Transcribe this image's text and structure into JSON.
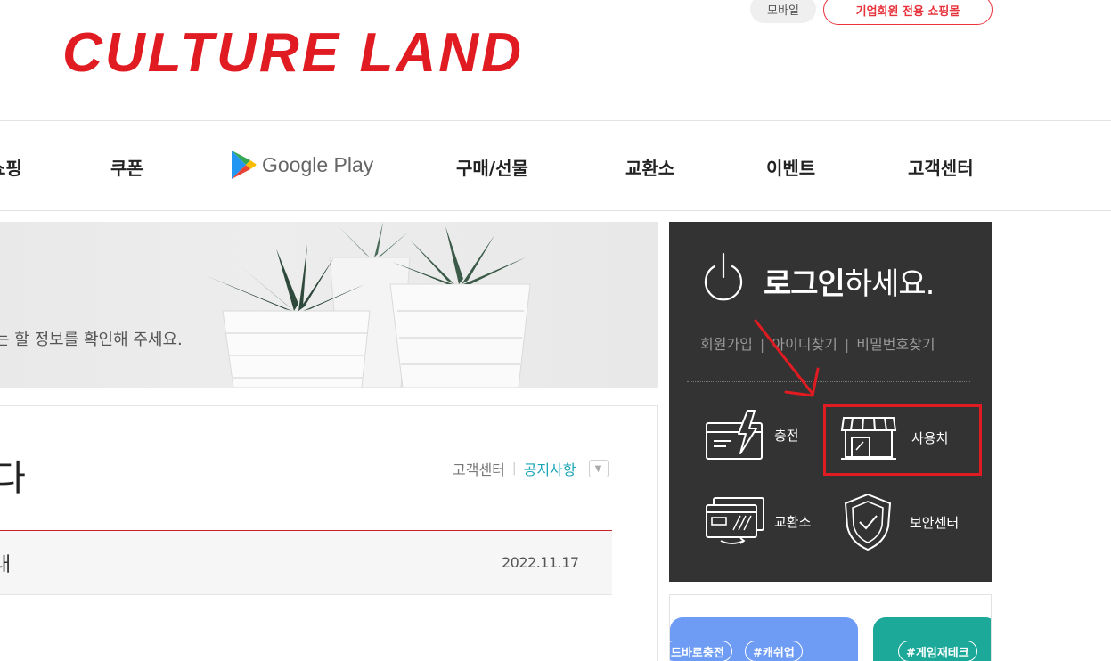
{
  "header": {
    "logo_text": "CULTURE LAND",
    "mobile_label": "모바일",
    "corporate_label": "기업회원 전용 쇼핑몰"
  },
  "nav": {
    "items": [
      "쇼핑",
      "쿠폰",
      "구매/선물",
      "교환소",
      "이벤트",
      "고객센터"
    ],
    "google_play_label": "Google Play"
  },
  "banner": {
    "text": "는 할 정보를 확인해 주세요."
  },
  "notice": {
    "heading_fragment": "다",
    "link_customer_center": "고객센터",
    "link_notice": "공지사항",
    "row_title": "내",
    "row_date": "2022.11.17"
  },
  "login": {
    "title_bold": "로그인",
    "title_rest": "하세요.",
    "links": [
      "회원가입",
      "아이디찾기",
      "비밀번호찾기"
    ],
    "separator": "|",
    "quick": {
      "charge": "충전",
      "stores": "사용처",
      "exchange": "교환소",
      "security": "보안센터"
    }
  },
  "promo": {
    "tags_blue": [
      "드바로충전",
      "#캐쉬업"
    ],
    "tags_green": [
      "#게임재테크"
    ]
  },
  "colors": {
    "brand_red": "#e11b22",
    "panel_dark": "#333333",
    "link_teal": "#1aa6b7"
  }
}
